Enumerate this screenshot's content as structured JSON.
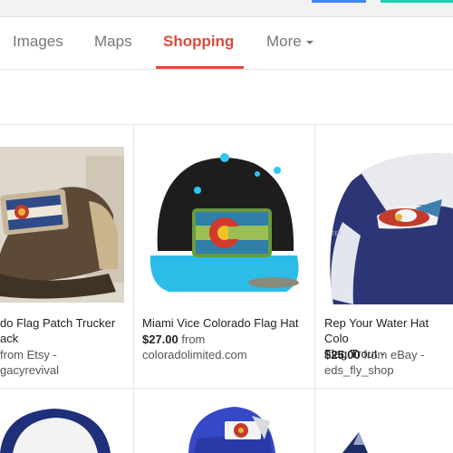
{
  "tabs": [
    {
      "label": "Images"
    },
    {
      "label": "Maps"
    },
    {
      "label": "Shopping"
    },
    {
      "label": "More"
    }
  ],
  "products": [
    {
      "title_line1": "do Flag Patch Trucker",
      "title_line2": "ack",
      "price": "",
      "price_prefix": "",
      "from_text": "from Etsy -",
      "seller": "gacyrevival"
    },
    {
      "title_line1": "Miami Vice Colorado Flag Hat",
      "title_line2": "",
      "price": "$27.00",
      "price_prefix": "",
      "from_text": "from",
      "seller": "coloradolimited.com"
    },
    {
      "title_line1": "Rep Your Water Hat Colo",
      "title_line2": "Flag Trout -",
      "price": "$25.00",
      "price_prefix": "",
      "from_text": "from eBay -",
      "seller": "eds_fly_shop"
    }
  ],
  "colors": {
    "accent": "#dd4b39",
    "tab_text": "#777777"
  }
}
